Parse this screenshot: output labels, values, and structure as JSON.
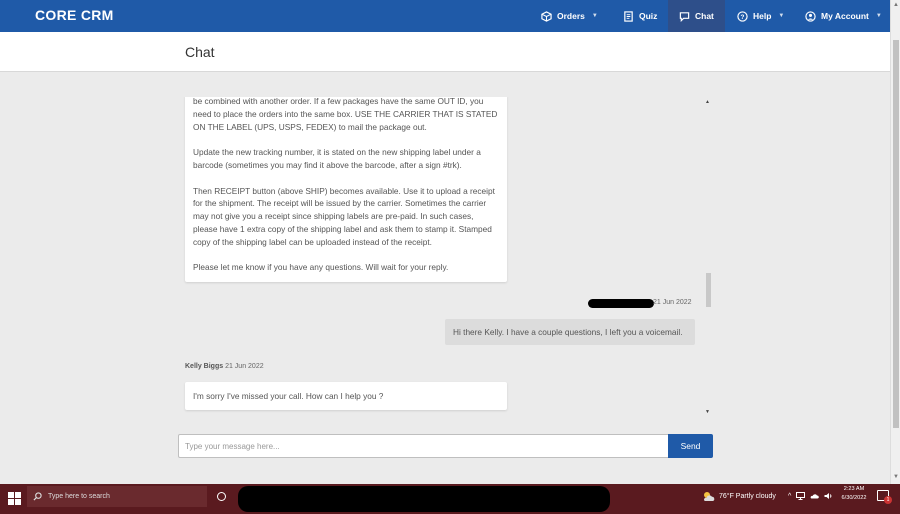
{
  "nav": {
    "brand": "CORE CRM",
    "items": [
      {
        "label": "Orders",
        "icon": "box-icon",
        "caret": true
      },
      {
        "label": "Quiz",
        "icon": "document-icon",
        "caret": false
      },
      {
        "label": "Chat",
        "icon": "chat-icon",
        "caret": false,
        "active": true
      },
      {
        "label": "Help",
        "icon": "help-icon",
        "caret": true
      },
      {
        "label": "My Account",
        "icon": "user-icon",
        "caret": true
      }
    ],
    "caret_glyph": "▼"
  },
  "page": {
    "title": "Chat"
  },
  "messages": [
    {
      "direction": "incoming",
      "paragraphs": [
        "be combined with another order. If a few packages have the same OUT ID, you need to place the orders into the same box. USE THE CARRIER THAT IS STATED ON THE LABEL (UPS, USPS, FEDEX) to mail the package out.",
        "Update the new tracking number, it is stated on the new shipping label under a barcode (sometimes you may find it above the barcode, after a sign #trk).",
        "Then RECEIPT button (above SHIP) becomes available. Use it to upload a receipt for the shipment. The receipt will be issued by the carrier. Sometimes the carrier may not give you a receipt since shipping labels are pre-paid. In such cases, please have 1 extra copy of the shipping label and ask them to stamp it. Stamped copy of the shipping label can be uploaded instead of the receipt.",
        "Please let me know if you have any questions. Will wait for your reply."
      ]
    },
    {
      "direction": "outgoing",
      "date": "21 Jun 2022",
      "text": "Hi there Kelly. I have a couple questions, I left you a voicemail."
    },
    {
      "direction": "incoming",
      "sender": "Kelly Biggs",
      "date": "21 Jun 2022",
      "text": "I'm sorry I've missed your call. How can I help you ?"
    }
  ],
  "composer": {
    "placeholder": "Type your message here...",
    "send_label": "Send"
  },
  "taskbar": {
    "search_placeholder": "Type here to search",
    "weather": "76°F  Partly cloudy",
    "time": "2:23 AM",
    "date": "6/30/2022",
    "notification_count": "1"
  },
  "colors": {
    "nav_bg": "#1f5aa8",
    "nav_active": "#2e4f8a",
    "taskbar_bg": "#5a1a1f",
    "page_bg": "#ebebeb"
  }
}
